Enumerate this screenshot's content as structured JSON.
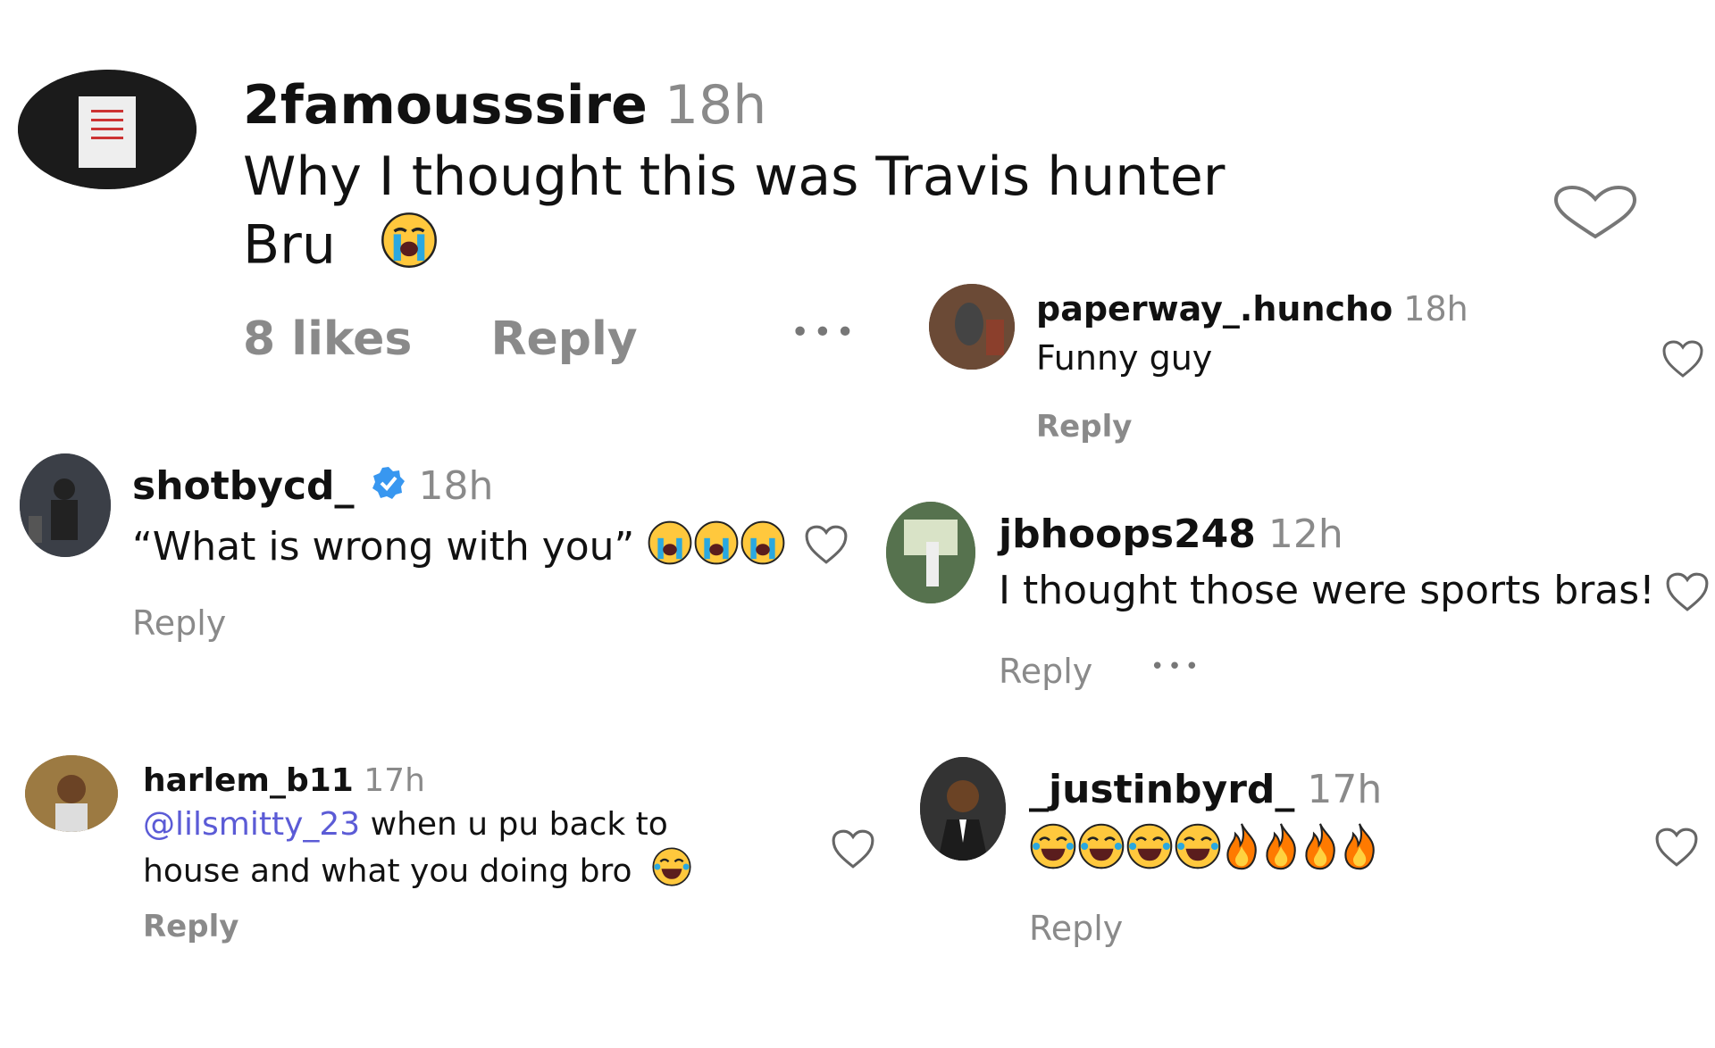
{
  "comments": {
    "c1": {
      "username": "2famousssire",
      "time": "18h",
      "text_line1": "Why I thought this was Travis hunter",
      "text_line2": "Bru",
      "emoji": "crying-face",
      "likes": "8 likes",
      "reply": "Reply",
      "more": "•••"
    },
    "c2": {
      "username": "paperway_.huncho",
      "time": "18h",
      "text": "Funny guy",
      "reply": "Reply"
    },
    "c3": {
      "username": "shotbycd_",
      "time": "18h",
      "text": "“What is wrong with you”",
      "emoji": "crying-face x3",
      "verified": true,
      "reply": "Reply"
    },
    "c4": {
      "username": "jbhoops248",
      "time": "12h",
      "text": "I thought those were sports bras!",
      "reply": "Reply",
      "more": "•••"
    },
    "c5": {
      "username": "harlem_b11",
      "time": "17h",
      "mention": "@lilsmitty_23",
      "text_line1": " when u pu back to",
      "text_line2": "house and what you doing bro",
      "emoji": "laughing-face",
      "reply": "Reply"
    },
    "c6": {
      "username": "_justinbyrd_",
      "time": "17h",
      "emoji": "laughing-face x4, fire x4",
      "reply": "Reply"
    }
  },
  "colors": {
    "mention": "#5b5bd6",
    "muted": "#8a8a8a",
    "verified": "#3897f0"
  }
}
